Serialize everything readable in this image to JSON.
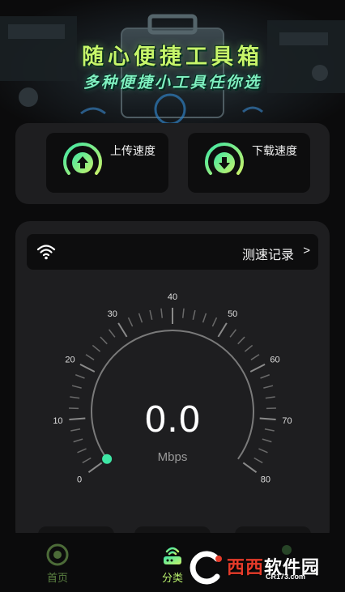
{
  "banner": {
    "title": "随心便捷工具箱",
    "subtitle": "多种便捷小工具任你选"
  },
  "speed_cards": {
    "upload": {
      "label": "上传速度",
      "icon": "upload-gauge-icon"
    },
    "download": {
      "label": "下载速度",
      "icon": "download-gauge-icon"
    }
  },
  "speed_test": {
    "wifi_icon": "wifi-icon",
    "record_label": "测速记录",
    "chevron": ">",
    "value": "0.0",
    "unit": "Mbps",
    "level": 0,
    "scale_labels": [
      "0",
      "10",
      "20",
      "30",
      "40",
      "50",
      "60",
      "70",
      "80"
    ]
  },
  "bottom_nav": {
    "items": [
      {
        "label": "首页",
        "icon": "home-target-icon",
        "active": false
      },
      {
        "label": "分类",
        "icon": "router-icon",
        "active": true
      }
    ]
  },
  "watermark": {
    "brand_part1": "西西",
    "brand_part2": "软件园",
    "url": "CR173.com"
  },
  "colors": {
    "accent_green": "#9be06e",
    "gauge_gradient_start": "#3ee7a5",
    "gauge_gradient_end": "#c8f26a",
    "card_bg": "#1e1e20",
    "inner_bg": "#0d0d0e"
  }
}
